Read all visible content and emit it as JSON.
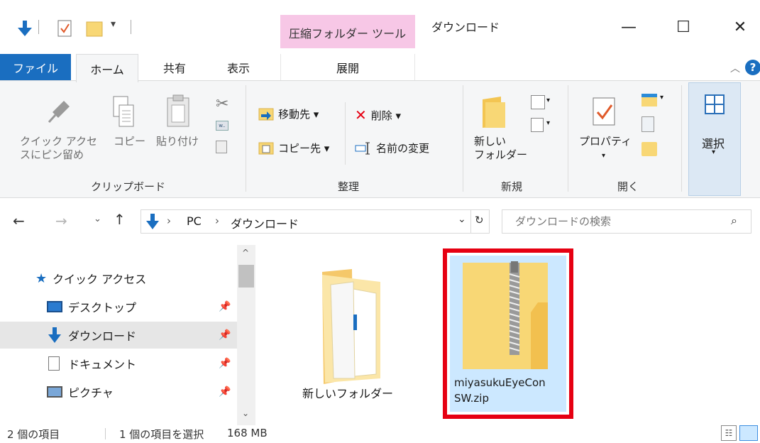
{
  "titlebar": {
    "context_tab": "圧縮フォルダー ツール",
    "window_title": "ダウンロード",
    "minimize": "—",
    "maximize": "☐",
    "close": "✕"
  },
  "tabs": {
    "file": "ファイル",
    "home": "ホーム",
    "share": "共有",
    "view": "表示",
    "expand": "展開"
  },
  "ribbon": {
    "clipboard": {
      "pin_line1": "クイック アクセ",
      "pin_line2": "スにピン留め",
      "copy": "コピー",
      "paste": "貼り付け",
      "label": "クリップボード"
    },
    "organize": {
      "move_to": "移動先 ▾",
      "delete": "削除 ▾",
      "copy_to": "コピー先 ▾",
      "rename": "名前の変更",
      "label": "整理"
    },
    "new": {
      "folder_line1": "新しい",
      "folder_line2": "フォルダー",
      "label": "新規"
    },
    "open": {
      "properties": "プロパティ",
      "label": "開く"
    },
    "select": {
      "select": "選択"
    }
  },
  "address": {
    "path": [
      "PC",
      "ダウンロード"
    ],
    "search_placeholder": "ダウンロードの検索"
  },
  "nav": {
    "items": [
      {
        "label": "クイック アクセス",
        "icon": "star-icon"
      },
      {
        "label": "デスクトップ",
        "icon": "desktop-icon"
      },
      {
        "label": "ダウンロード",
        "icon": "download-icon"
      },
      {
        "label": "ドキュメント",
        "icon": "document-icon"
      },
      {
        "label": "ピクチャ",
        "icon": "picture-icon"
      }
    ]
  },
  "files": [
    {
      "name": "新しいフォルダー",
      "type": "folder"
    },
    {
      "name_line1": "miyasukuEyeCon",
      "name_line2": "SW.zip",
      "type": "zip",
      "selected": true
    }
  ],
  "status": {
    "count": "2 個の項目",
    "selected": "1 個の項目を選択",
    "size": "168 MB"
  },
  "colors": {
    "accent": "#1a6ec0",
    "highlight": "#e60012",
    "selection": "#cce8ff",
    "context_tab": "#f7c7e6"
  }
}
